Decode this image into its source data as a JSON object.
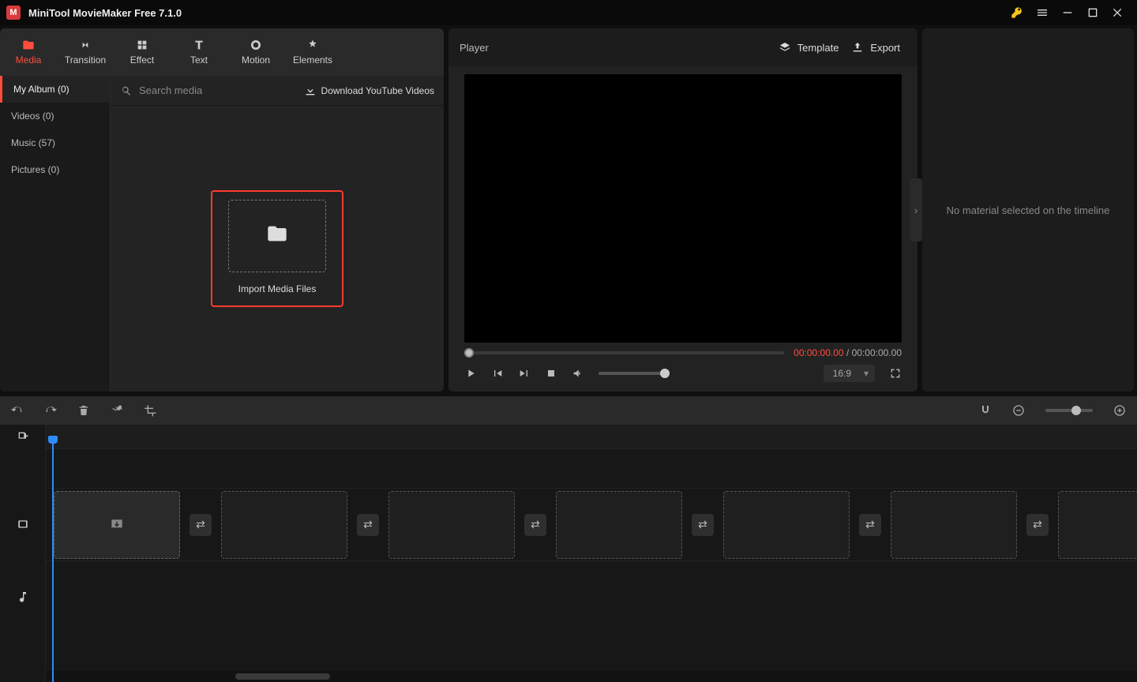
{
  "app": {
    "title": "MiniTool MovieMaker Free 7.1.0"
  },
  "tabs": {
    "media": "Media",
    "transition": "Transition",
    "effect": "Effect",
    "text": "Text",
    "motion": "Motion",
    "elements": "Elements"
  },
  "sidebar": {
    "items": [
      {
        "label": "My Album (0)"
      },
      {
        "label": "Videos (0)"
      },
      {
        "label": "Music (57)"
      },
      {
        "label": "Pictures (0)"
      }
    ]
  },
  "media_panel": {
    "search_placeholder": "Search media",
    "download_link": "Download YouTube Videos",
    "import_label": "Import Media Files"
  },
  "player": {
    "title": "Player",
    "template_label": "Template",
    "export_label": "Export",
    "time_current": "00:00:00.00",
    "time_separator": " / ",
    "time_total": "00:00:00.00",
    "ratio": "16:9"
  },
  "inspector": {
    "empty_text": "No material selected on the timeline"
  }
}
